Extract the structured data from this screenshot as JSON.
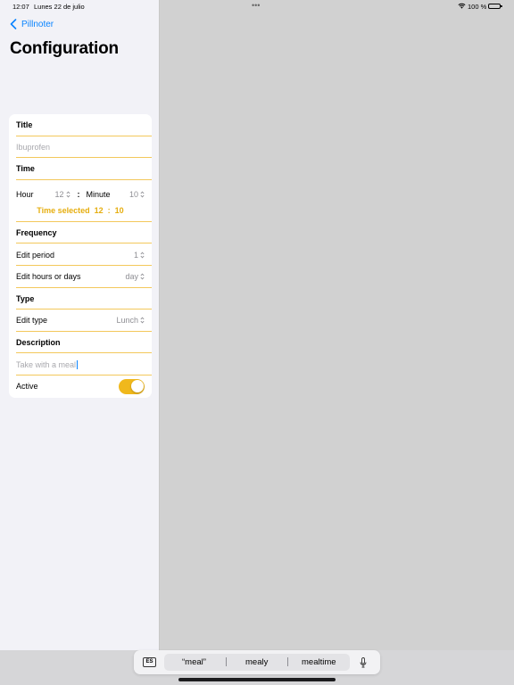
{
  "status": {
    "time": "12:07",
    "date": "Lunes 22 de julio",
    "multitask": "•••",
    "battery": "100 %"
  },
  "nav": {
    "back_label": "Pillnoter",
    "title": "Configuration"
  },
  "form": {
    "title_header": "Title",
    "title_placeholder": "Ibuprofen",
    "time_header": "Time",
    "hour_label": "Hour",
    "hour_value": "12",
    "separator": ":",
    "minute_label": "Minute",
    "minute_value": "10",
    "time_selected": "Time selected  12  :  10",
    "frequency_header": "Frequency",
    "edit_period_label": "Edit period",
    "edit_period_value": "1",
    "edit_hours_label": "Edit hours or days",
    "edit_hours_value": "day",
    "type_header": "Type",
    "edit_type_label": "Edit type",
    "edit_type_value": "Lunch",
    "description_header": "Description",
    "description_value": "Take with a meal",
    "active_label": "Active",
    "active": true
  },
  "keyboard": {
    "lang": "ES",
    "suggestions": [
      "“meal”",
      "mealy",
      "mealtime"
    ]
  },
  "colors": {
    "accent": "#f0b81c",
    "link": "#0a84ff"
  }
}
